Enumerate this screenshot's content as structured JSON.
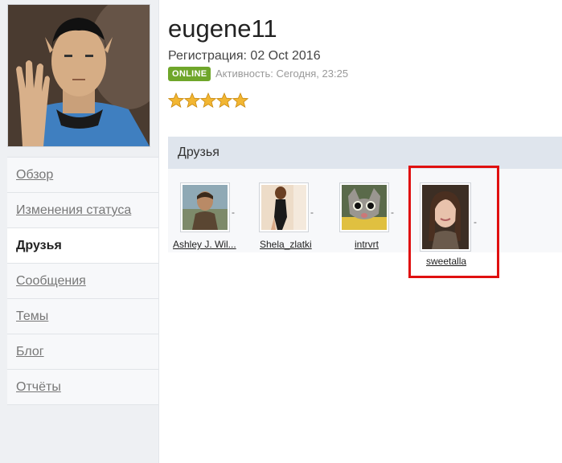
{
  "profile": {
    "username": "eugene11",
    "registration": "Регистрация: 02 Oct 2016",
    "status_badge": "ONLINE",
    "activity": "Активность: Сегодня, 23:25",
    "rating_stars": 5
  },
  "sidebar": {
    "items": [
      {
        "label": "Обзор",
        "active": false
      },
      {
        "label": "Изменения статуса",
        "active": false
      },
      {
        "label": "Друзья",
        "active": true
      },
      {
        "label": "Сообщения",
        "active": false
      },
      {
        "label": "Темы",
        "active": false
      },
      {
        "label": "Блог",
        "active": false
      },
      {
        "label": "Отчёты",
        "active": false
      }
    ]
  },
  "friends": {
    "title": "Друзья",
    "list": [
      {
        "name": "Ashley J. Wil..."
      },
      {
        "name": "Shela_zlatki"
      },
      {
        "name": "intrvrt"
      },
      {
        "name": "sweetalla"
      }
    ]
  },
  "colors": {
    "online": "#6fa62a",
    "section_header": "#dfe5ed",
    "highlight": "#e01010"
  }
}
